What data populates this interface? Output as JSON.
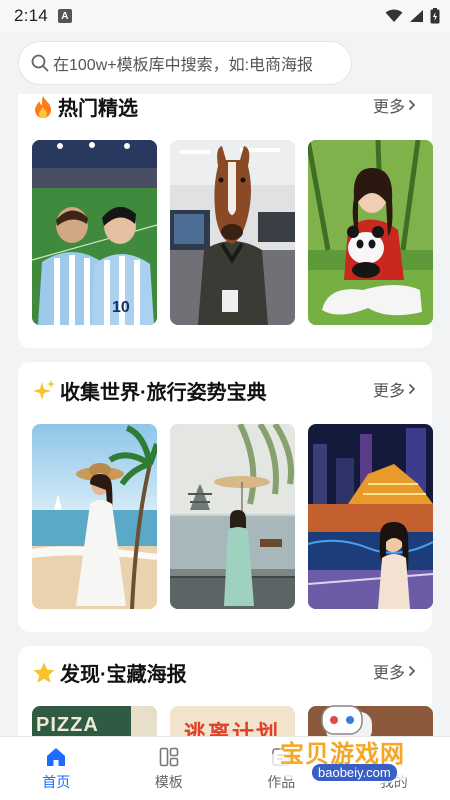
{
  "status_bar": {
    "time": "2:14",
    "notification_letter": "A"
  },
  "search": {
    "placeholder": "在100w+模板库中搜索，如:电商海报"
  },
  "sections": [
    {
      "title": "热门精选",
      "title_icon": "fire-icon",
      "more_label": "更多"
    },
    {
      "title": "收集世界·旅行姿势宝典",
      "title_icon": "sparkle-icon",
      "more_label": "更多"
    },
    {
      "title": "发现·宝藏海报",
      "title_icon": "star-icon",
      "more_label": "更多"
    }
  ],
  "poster_texts": {
    "pizza": "PIZZA",
    "chinese": "逃离计划"
  },
  "tabbar": {
    "items": [
      {
        "label": "首页",
        "icon": "home-icon",
        "active": true
      },
      {
        "label": "模板",
        "icon": "template-icon",
        "active": false
      },
      {
        "label": "作品",
        "icon": "works-icon",
        "active": false
      },
      {
        "label": "我的",
        "icon": "profile-icon",
        "active": false
      }
    ]
  },
  "watermark": {
    "title": "宝贝游戏网",
    "url": "baobeiy.com"
  },
  "colors": {
    "accent": "#1e6bff",
    "background": "#f2f3f5"
  }
}
